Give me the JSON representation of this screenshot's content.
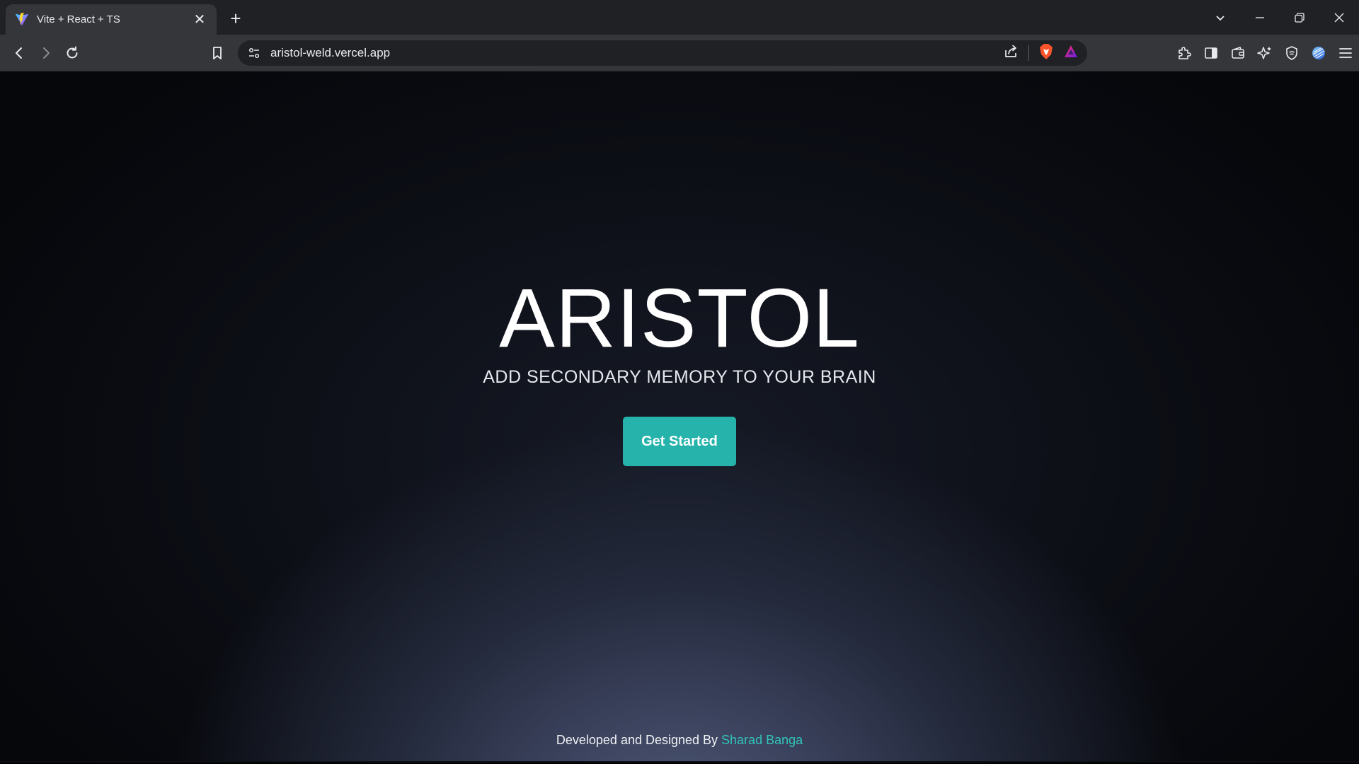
{
  "tab": {
    "title": "Vite + React + TS",
    "close_glyph": "✕",
    "favicon": "vite-icon"
  },
  "new_tab_glyph": "+",
  "toolbar": {
    "url": "aristol-weld.vercel.app"
  },
  "page": {
    "brand": "ARISTOL",
    "tagline": "ADD SECONDARY MEMORY TO YOUR BRAIN",
    "cta_label": "Get Started",
    "footer_text": "Developed and Designed By ",
    "footer_link": "Sharad Banga"
  },
  "colors": {
    "accent": "#26b3ab",
    "link": "#31c4bb",
    "chrome_dark": "#202124",
    "chrome_toolbar": "#35363a"
  }
}
